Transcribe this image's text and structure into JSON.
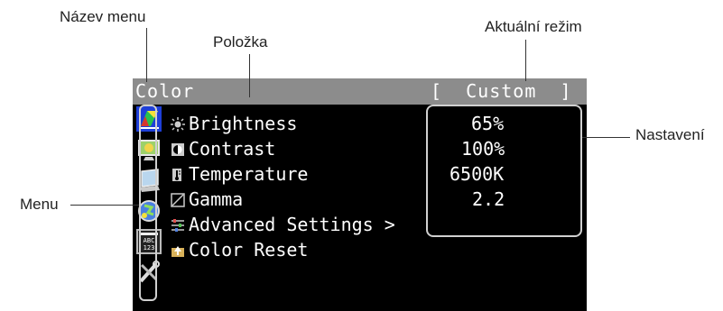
{
  "callouts": {
    "menu_name": "Název menu",
    "item": "Položka",
    "current_mode": "Aktuální režim",
    "settings": "Nastavení",
    "menu": "Menu"
  },
  "osd": {
    "title": "Color",
    "mode": "[  Custom  ]",
    "menu_icons": [
      "color-icon",
      "screen-icon",
      "monitor-settings-icon",
      "power-save-icon",
      "language-icon",
      "tools-icon"
    ],
    "items": [
      {
        "label": "Brightness",
        "icon": "brightness-icon",
        "value": "65%"
      },
      {
        "label": "Contrast",
        "icon": "contrast-icon",
        "value": "100%"
      },
      {
        "label": "Temperature",
        "icon": "temperature-icon",
        "value": "6500K"
      },
      {
        "label": "Gamma",
        "icon": "gamma-icon",
        "value": "2.2"
      },
      {
        "label": "Advanced Settings >",
        "icon": "advanced-settings-icon",
        "value": ""
      },
      {
        "label": "Color Reset",
        "icon": "reset-icon",
        "value": ""
      }
    ]
  }
}
